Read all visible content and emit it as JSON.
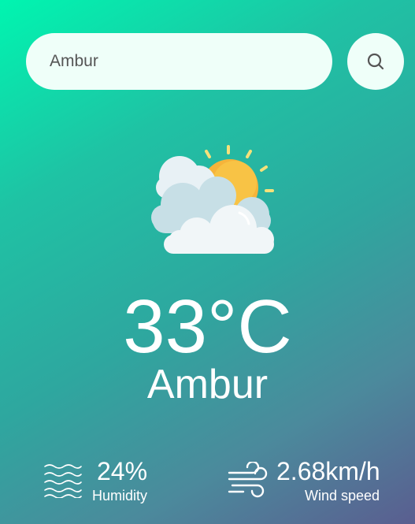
{
  "search": {
    "value": "Ambur",
    "placeholder": "",
    "button_icon": "search-icon"
  },
  "weather": {
    "icon": "partly-cloudy-sun-icon",
    "temperature": "33°C",
    "city": "Ambur"
  },
  "details": {
    "humidity": {
      "icon": "waves-icon",
      "value": "24%",
      "label": "Humidity"
    },
    "wind": {
      "icon": "wind-icon",
      "value": "2.68km/h",
      "label": "Wind speed"
    }
  },
  "colors": {
    "gradient_start": "#00f5b0",
    "gradient_end": "#5a5e90",
    "search_background": "#effff9",
    "text": "#ffffff"
  }
}
